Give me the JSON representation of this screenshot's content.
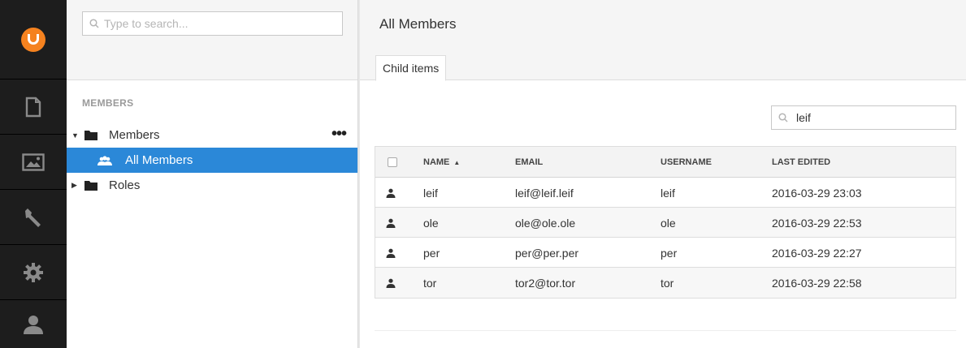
{
  "tree": {
    "search_placeholder": "Type to search...",
    "section_label": "MEMBERS",
    "nodes": [
      {
        "label": "Members",
        "expanded": true
      },
      {
        "label": "All Members",
        "selected": true
      },
      {
        "label": "Roles",
        "expanded": false
      }
    ],
    "actions_label": "•••"
  },
  "main": {
    "title": "All Members",
    "tab_label": "Child items",
    "search_value": "leif",
    "columns": [
      "NAME",
      "EMAIL",
      "USERNAME",
      "LAST EDITED"
    ],
    "sort_indicator": "▲",
    "rows": [
      {
        "name": "leif",
        "email": "leif@leif.leif",
        "username": "leif",
        "last_edited": "2016-03-29 23:03"
      },
      {
        "name": "ole",
        "email": "ole@ole.ole",
        "username": "ole",
        "last_edited": "2016-03-29 22:53"
      },
      {
        "name": "per",
        "email": "per@per.per",
        "username": "per",
        "last_edited": "2016-03-29 22:27"
      },
      {
        "name": "tor",
        "email": "tor2@tor.tor",
        "username": "tor",
        "last_edited": "2016-03-29 22:58"
      }
    ]
  },
  "colors": {
    "accent": "#2b88d8",
    "logo": "#f5821f",
    "rail": "#1d1d1d"
  },
  "icons": [
    "umbraco-logo-icon",
    "content-icon",
    "media-icon",
    "settings-wrench-icon",
    "developer-gear-icon",
    "members-user-icon"
  ]
}
